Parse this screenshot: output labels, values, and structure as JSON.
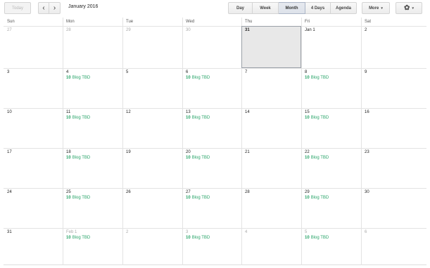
{
  "toolbar": {
    "today_label": "Today",
    "prev_glyph": "‹",
    "next_glyph": "›",
    "date_range": "January 2016",
    "views": [
      "Day",
      "Week",
      "Month",
      "4 Days",
      "Agenda"
    ],
    "active_view": "Month",
    "more_label": "More",
    "caret": "▾",
    "settings_glyph": "✿"
  },
  "weekdays": [
    "Sun",
    "Mon",
    "Tue",
    "Wed",
    "Thu",
    "Fri",
    "Sat"
  ],
  "weeks": [
    [
      {
        "label": "27",
        "other": true
      },
      {
        "label": "28",
        "other": true
      },
      {
        "label": "29",
        "other": true
      },
      {
        "label": "30",
        "other": true
      },
      {
        "label": "31",
        "today": true
      },
      {
        "label": "Jan 1"
      },
      {
        "label": "2"
      }
    ],
    [
      {
        "label": "3"
      },
      {
        "label": "4",
        "event": true
      },
      {
        "label": "5"
      },
      {
        "label": "6",
        "event": true
      },
      {
        "label": "7"
      },
      {
        "label": "8",
        "event": true
      },
      {
        "label": "9"
      }
    ],
    [
      {
        "label": "10"
      },
      {
        "label": "11",
        "event": true
      },
      {
        "label": "12"
      },
      {
        "label": "13",
        "event": true
      },
      {
        "label": "14"
      },
      {
        "label": "15",
        "event": true
      },
      {
        "label": "16"
      }
    ],
    [
      {
        "label": "17"
      },
      {
        "label": "18",
        "event": true
      },
      {
        "label": "19"
      },
      {
        "label": "20",
        "event": true
      },
      {
        "label": "21"
      },
      {
        "label": "22",
        "event": true
      },
      {
        "label": "23"
      }
    ],
    [
      {
        "label": "24"
      },
      {
        "label": "25",
        "event": true
      },
      {
        "label": "26"
      },
      {
        "label": "27",
        "event": true
      },
      {
        "label": "28"
      },
      {
        "label": "29",
        "event": true
      },
      {
        "label": "30"
      }
    ],
    [
      {
        "label": "31"
      },
      {
        "label": "Feb 1",
        "other": true,
        "event": true
      },
      {
        "label": "2",
        "other": true
      },
      {
        "label": "3",
        "other": true,
        "event": true
      },
      {
        "label": "4",
        "other": true
      },
      {
        "label": "5",
        "other": true,
        "event": true
      },
      {
        "label": "6",
        "other": true
      }
    ]
  ],
  "event": {
    "time": "10",
    "title": "Blog TBD"
  },
  "colors": {
    "event": "#2aa56a",
    "today_bg": "#e8e8e8",
    "active_view_bg": "#dde2ea"
  }
}
